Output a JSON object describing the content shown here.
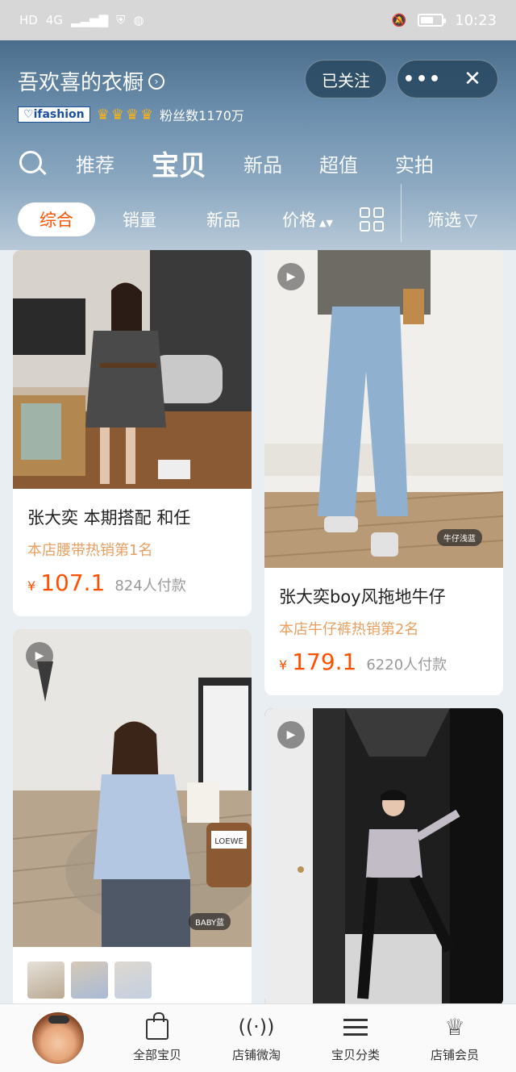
{
  "status_bar": {
    "left_labels": [
      "HD",
      "4G"
    ],
    "time": "10:23",
    "battery_level": 0.6
  },
  "header": {
    "shop_name": "吾欢喜的衣橱",
    "follow_label": "已关注",
    "more_label": "•••",
    "close_label": "✕",
    "brand_badge": "ifashion",
    "crown_count": 4,
    "fans": "粉丝数1170万"
  },
  "nav": {
    "tabs": [
      "推荐",
      "宝贝",
      "新品",
      "超值",
      "实拍"
    ],
    "active_tab": "宝贝"
  },
  "sort": {
    "items": [
      "综合",
      "销量",
      "新品",
      "价格",
      "筛选"
    ],
    "active": "综合",
    "price_arrows": "▲▼",
    "filter_icon": "▽"
  },
  "products": [
    {
      "title": "张大奕  本期搭配  和任",
      "rank": "本店腰带热销第1名",
      "currency": "¥",
      "price": "107.1",
      "sales": "824人付款",
      "image_desc": "woman-in-grey-blazer"
    },
    {
      "title": "张大奕boy风拖地牛仔",
      "rank": "本店牛仔裤热销第2名",
      "currency": "¥",
      "price": "179.1",
      "sales": "6220人付款",
      "image_tag": "牛仔浅蓝",
      "image_desc": "wide-leg-jeans"
    },
    {
      "image_tag": "BABY蓝",
      "image_desc": "blue-knit-sweater",
      "bag_text": "LOEWE"
    },
    {
      "image_desc": "black-leggings-outfit"
    }
  ],
  "bottom_nav": {
    "items": [
      "全部宝贝",
      "店铺微淘",
      "宝贝分类",
      "店铺会员"
    ]
  },
  "colors": {
    "accent": "#ff5000",
    "rank_text": "#e8a062",
    "header_bg": "#5a7d9c"
  }
}
